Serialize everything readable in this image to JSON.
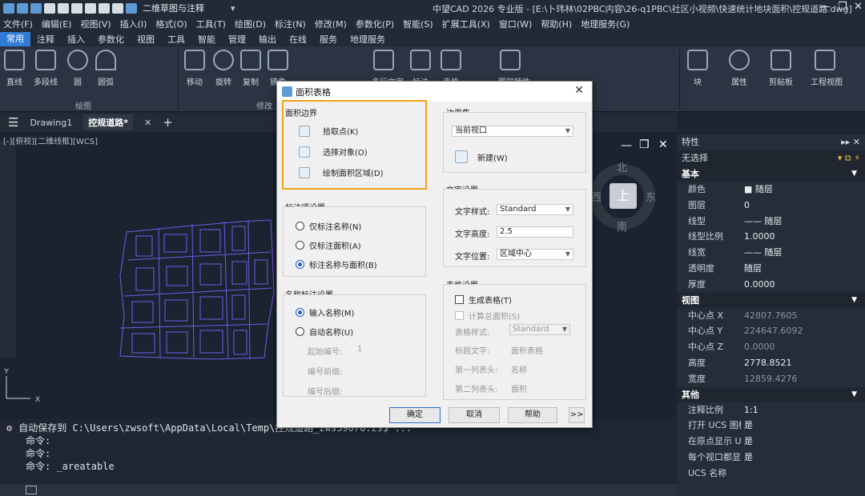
{
  "titlebar": {
    "workspace": "二维草图与注释",
    "title": "中望CAD 2026 专业版 - [E:\\卜玮林\\02PBC内容\\26-q1PBC\\社区小视频\\快速统计地块面积\\控规道路.dwg]"
  },
  "menu": [
    "文件(F)",
    "编辑(E)",
    "视图(V)",
    "插入(I)",
    "格式(O)",
    "工具(T)",
    "绘图(D)",
    "标注(N)",
    "修改(M)",
    "参数化(P)",
    "智能(S)",
    "扩展工具(X)",
    "窗口(W)",
    "帮助(H)",
    "地理服务(G)"
  ],
  "ribbon_tabs": [
    "常用",
    "注释",
    "插入",
    "参数化",
    "视图",
    "工具",
    "智能",
    "管理",
    "输出",
    "在线",
    "服务",
    "地理服务"
  ],
  "ribbon": {
    "draw": [
      "直线",
      "多段线",
      "圆",
      "圆弧"
    ],
    "modify": [
      "移动",
      "旋转",
      "复制",
      "镜像"
    ],
    "annotate": [
      "多行文字",
      "标注",
      "表格"
    ],
    "layer": [
      "图层特性"
    ],
    "right": [
      "块",
      "属性",
      "剪贴板",
      "工程视图"
    ],
    "group_draw": "绘图",
    "group_modify": "修改"
  },
  "doctabs": [
    "Drawing1",
    "控规道路*"
  ],
  "viewlabel": "[-][俯视][二维线框][WCS]",
  "compass": {
    "n": "北",
    "s": "南",
    "e": "东",
    "w": "西",
    "center": "上"
  },
  "cmd": [
    "自动保存到 C:\\Users\\zwsoft\\AppData\\Local\\Temp\\控规道路_zws59076.zs$ ...",
    "命令:",
    "命令:",
    "命令: _areatable"
  ],
  "props": {
    "title": "特性",
    "selection": "无选择",
    "sections": [
      {
        "name": "基本",
        "rows": [
          [
            "颜色",
            "随层"
          ],
          [
            "图层",
            "0"
          ],
          [
            "线型",
            "—— 随层"
          ],
          [
            "线型比例",
            "1.0000"
          ],
          [
            "线宽",
            "—— 随层"
          ],
          [
            "透明度",
            "随层"
          ],
          [
            "厚度",
            "0.0000"
          ]
        ]
      },
      {
        "name": "视图",
        "rows": [
          [
            "中心点 X",
            "42807.7605"
          ],
          [
            "中心点 Y",
            "224647.6092"
          ],
          [
            "中心点 Z",
            "0.0000"
          ],
          [
            "高度",
            "2778.8521"
          ],
          [
            "宽度",
            "12859.4276"
          ]
        ]
      },
      {
        "name": "其他",
        "rows": [
          [
            "注释比例",
            "1:1"
          ],
          [
            "打开 UCS 图标",
            "是"
          ],
          [
            "在原点显示 U...",
            "是"
          ],
          [
            "每个视口都显...",
            "是"
          ],
          [
            "UCS 名称",
            ""
          ]
        ]
      }
    ]
  },
  "dialog": {
    "title": "面积表格",
    "boundary": {
      "title": "面积边界",
      "pick": "拾取点(K)",
      "select": "选择对象(O)",
      "draw": "绘制面积区域(D)"
    },
    "label_settings": {
      "title": "标注项设置",
      "opt1": "仅标注名称(N)",
      "opt2": "仅标注面积(A)",
      "opt3": "标注名称与面积(B)"
    },
    "name_settings": {
      "title": "名称标注设置",
      "opt1": "输入名称(M)",
      "opt2": "自动名称(U)",
      "start_label": "起始编号:",
      "start_val": "1",
      "prefix_label": "编号前缀:",
      "suffix_label": "编号后缀:"
    },
    "boundary_set": {
      "title": "边界集",
      "value": "当前视口",
      "new": "新建(W)"
    },
    "text": {
      "title": "文字设置",
      "style_label": "文字样式:",
      "style": "Standard",
      "height_label": "文字高度:",
      "height": "2.5",
      "pos_label": "文字位置:",
      "pos": "区域中心"
    },
    "table": {
      "title": "表格设置",
      "gen": "生成表格(T)",
      "total": "计算总面积(S)",
      "style_label": "表格样式:",
      "style": "Standard",
      "title_label": "标题文字:",
      "title_val": "面积表格",
      "col1_label": "第一列表头:",
      "col1": "名称",
      "col2_label": "第二列表头:",
      "col2": "面积"
    },
    "buttons": {
      "ok": "确定",
      "cancel": "取消",
      "help": "帮助",
      "more": ">>"
    }
  }
}
